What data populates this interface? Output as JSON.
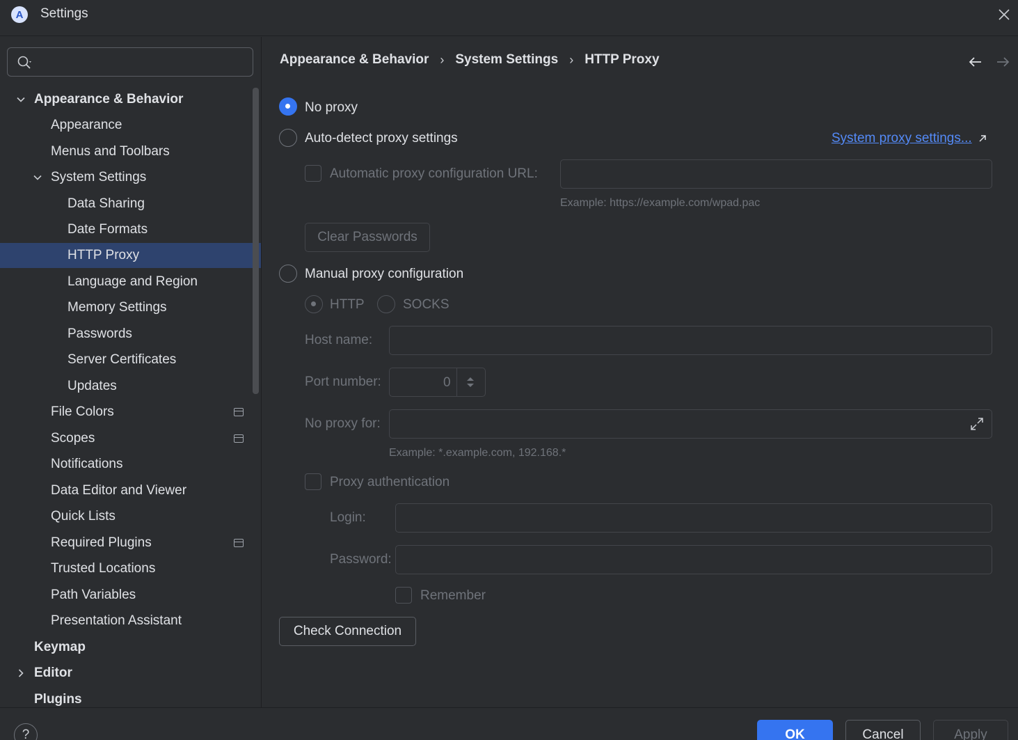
{
  "window": {
    "title": "Settings",
    "logo_letter": "A"
  },
  "search": {
    "placeholder": "",
    "value": ""
  },
  "tree": [
    {
      "label": "Appearance & Behavior",
      "bold": true,
      "expanded": true
    },
    {
      "label": "Appearance"
    },
    {
      "label": "Menus and Toolbars"
    },
    {
      "label": "System Settings",
      "expanded": true
    },
    {
      "label": "Data Sharing"
    },
    {
      "label": "Date Formats"
    },
    {
      "label": "HTTP Proxy",
      "selected": true
    },
    {
      "label": "Language and Region"
    },
    {
      "label": "Memory Settings"
    },
    {
      "label": "Passwords"
    },
    {
      "label": "Server Certificates"
    },
    {
      "label": "Updates"
    },
    {
      "label": "File Colors",
      "project_icon": true
    },
    {
      "label": "Scopes",
      "project_icon": true
    },
    {
      "label": "Notifications"
    },
    {
      "label": "Data Editor and Viewer"
    },
    {
      "label": "Quick Lists"
    },
    {
      "label": "Required Plugins",
      "project_icon": true
    },
    {
      "label": "Trusted Locations"
    },
    {
      "label": "Path Variables"
    },
    {
      "label": "Presentation Assistant"
    },
    {
      "label": "Keymap",
      "bold": true
    },
    {
      "label": "Editor",
      "bold": true,
      "expanded": false
    },
    {
      "label": "Plugins",
      "bold": true
    }
  ],
  "breadcrumb": [
    "Appearance & Behavior",
    "System Settings",
    "HTTP Proxy"
  ],
  "proxy": {
    "no_proxy_label": "No proxy",
    "auto_detect_label": "Auto-detect proxy settings",
    "system_proxy_link": "System proxy settings...",
    "auto_config_url_label": "Automatic proxy configuration URL:",
    "auto_config_url_value": "",
    "auto_config_url_hint": "Example: https://example.com/wpad.pac",
    "clear_passwords_label": "Clear Passwords",
    "manual_label": "Manual proxy configuration",
    "http_label": "HTTP",
    "socks_label": "SOCKS",
    "host_label": "Host name:",
    "host_value": "",
    "port_label": "Port number:",
    "port_value": "0",
    "no_proxy_for_label": "No proxy for:",
    "no_proxy_for_value": "",
    "no_proxy_for_hint": "Example: *.example.com, 192.168.*",
    "auth_label": "Proxy authentication",
    "login_label": "Login:",
    "login_value": "",
    "password_label": "Password:",
    "password_value": "",
    "remember_label": "Remember",
    "check_connection_label": "Check Connection",
    "selected_mode": "No proxy"
  },
  "footer": {
    "help": "?",
    "ok": "OK",
    "cancel": "Cancel",
    "apply": "Apply"
  },
  "colors": {
    "accent": "#3574f0",
    "selection": "#2e436e",
    "link": "#548af7",
    "background": "#2b2d30"
  }
}
